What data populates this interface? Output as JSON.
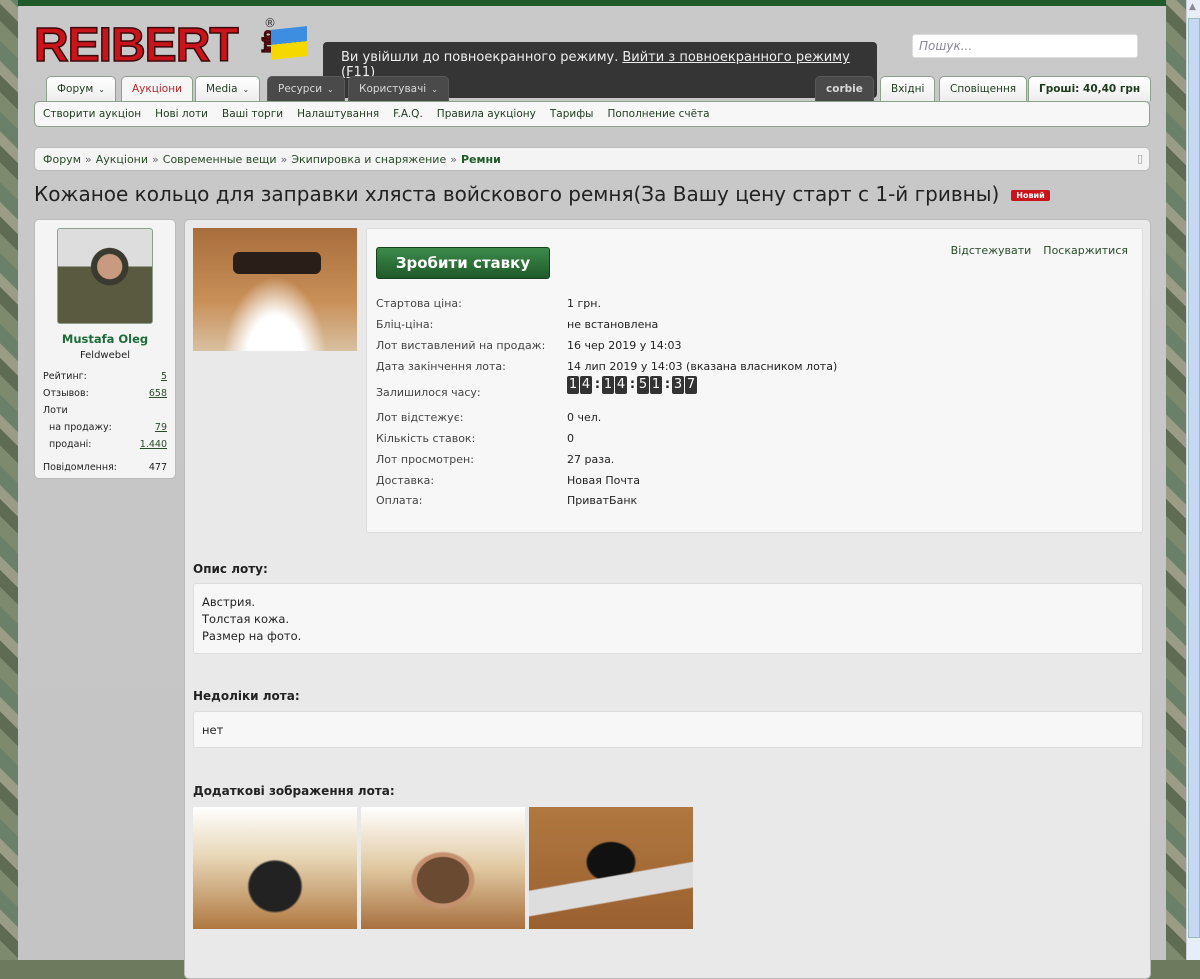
{
  "browser": {
    "fullscreen_notice": "Ви увійшли до повноекранного режиму.",
    "exit_fullscreen": "Вийти з повноекранного режиму (F11)"
  },
  "logo": {
    "text": "REIBERT",
    "suffix": "info",
    "reg": "®"
  },
  "search": {
    "placeholder": "Пошук..."
  },
  "nav": {
    "tabs": [
      "Форум",
      "Аукціони",
      "Media",
      "Ресурси",
      "Користувачі"
    ],
    "user": "corbie",
    "inbox": "Вхідні",
    "alerts": "Сповіщення",
    "money": "Гроші: 40,40 грн"
  },
  "subnav": [
    "Створити аукціон",
    "Нові лоти",
    "Ваші торги",
    "Налаштування",
    "F.A.Q.",
    "Правила аукціону",
    "Тарифы",
    "Пополнение счёта"
  ],
  "breadcrumb": [
    "Форум",
    "Аукціони",
    "Современные вещи",
    "Экипировка и снаряжение",
    "Ремни"
  ],
  "title": "Кожаное кольцо для заправки хляста войскового ремня(За Вашу цену старт с 1-й гривны)",
  "badge": "Новий",
  "seller": {
    "name": "Mustafa Oleg",
    "rank": "Feldwebel",
    "rating_label": "Рейтинг:",
    "rating": "5",
    "reviews_label": "Отзывов:",
    "reviews": "658",
    "lots_label": "Лоти",
    "for_sale_label": "на продажу:",
    "for_sale": "79",
    "sold_label": "продані:",
    "sold": "1.440",
    "messages_label": "Повідомлення:",
    "messages": "477"
  },
  "lot": {
    "bid_button": "Зробити ставку",
    "watch": "Відстежувати",
    "report": "Поскаржитися",
    "rows": [
      {
        "label": "Стартова ціна:",
        "value": "1 грн."
      },
      {
        "label": "Бліц-ціна:",
        "value": "не встановлена"
      },
      {
        "label": "Лот виставлений на продаж:",
        "value": "16 чер 2019 у 14:03"
      },
      {
        "label": "Дата закінчення лота:",
        "value": "14 лип 2019 у 14:03 (вказана власником лота)"
      },
      {
        "label": "Залишилося часу:",
        "value": ""
      },
      {
        "label": "Лот відстежує:",
        "value": "0 чел."
      },
      {
        "label": "Кількість ставок:",
        "value": "0"
      },
      {
        "label": "Лот просмотрен:",
        "value": "27 раза."
      },
      {
        "label": "Доставка:",
        "value": "Новая Почта"
      },
      {
        "label": "Оплата:",
        "value": "ПриватБанк"
      }
    ],
    "countdown": [
      "14",
      "14",
      "51",
      "37"
    ]
  },
  "description": {
    "heading": "Опис лоту:",
    "lines": [
      "Австрия.",
      "Толстая кожа.",
      "Размер на фото."
    ]
  },
  "defects": {
    "heading": "Недоліки лота:",
    "text": "нет"
  },
  "extra_images": {
    "heading": "Додаткові зображення лота:"
  }
}
